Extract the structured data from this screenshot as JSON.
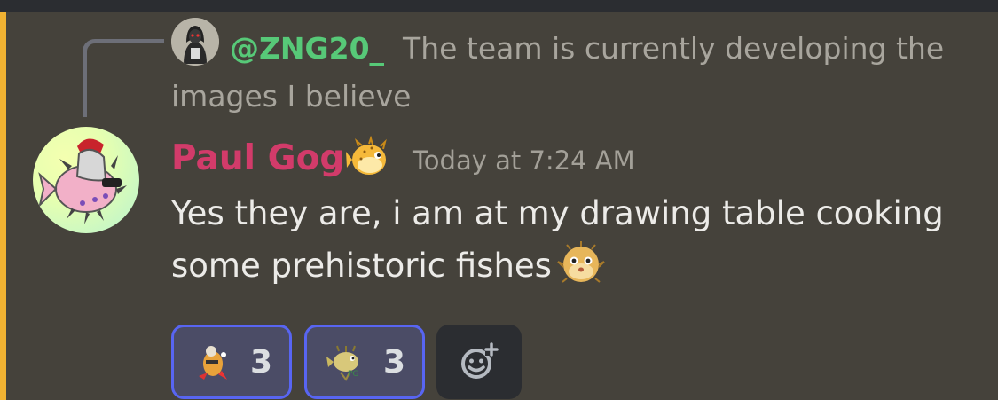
{
  "reply": {
    "mention": "@ZNG20_",
    "text": "The team is currently developing the images I believe"
  },
  "message": {
    "author": "Paul Gog",
    "author_color": "#d23b6a",
    "timestamp": "Today at 7:24 AM",
    "text": "Yes they are, i am at my drawing table cooking some prehistoric fishes",
    "trailing_emoji": "pufferfish"
  },
  "reactions": [
    {
      "emoji": "custom-character-emoji",
      "count": "3",
      "selected": true
    },
    {
      "emoji": "custom-fish-emoji",
      "count": "3",
      "selected": true
    }
  ],
  "add_reaction": {
    "icon": "add-reaction-icon"
  },
  "colors": {
    "background": "#45423b",
    "mention_bar": "#f0b232",
    "reply_mention": "#57c978",
    "reaction_border": "#5865f2"
  }
}
